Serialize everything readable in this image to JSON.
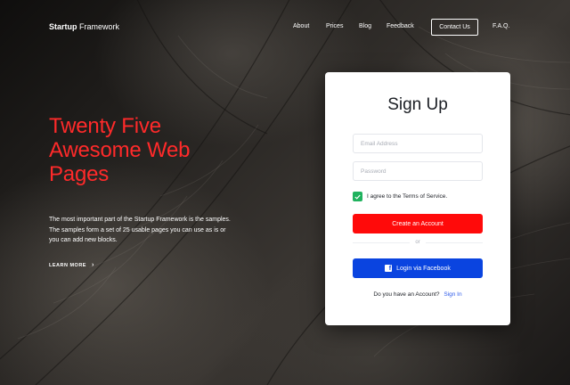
{
  "nav": {
    "brand_bold": "Startup",
    "brand_light": "Framework",
    "links": [
      "About",
      "Prices",
      "Blog",
      "Feedback"
    ],
    "contact_label": "Contact Us",
    "faq_label": "F.A.Q."
  },
  "hero": {
    "headline_lines": [
      "Twenty Five",
      "Awesome Web",
      "Pages"
    ],
    "description": "The most important part of the Startup Framework is the samples. The samples form a set of 25 usable pages you can use as is or you can add new blocks.",
    "learn_more": "LEARN MORE",
    "learn_more_icon": "chevron-right-icon"
  },
  "signup": {
    "title": "Sign Up",
    "email_placeholder": "Email Address",
    "password_placeholder": "Password",
    "terms_label": "I agree to the Terms of Service.",
    "terms_checked": true,
    "create_button": "Create an Account",
    "or_label": "or",
    "facebook_button": "Login via Facebook",
    "facebook_icon": "facebook-icon",
    "have_account": "Do you have an Account?",
    "sign_in_link": "Sign In"
  },
  "colors": {
    "headline": "#ff2a2a",
    "create_button": "#ff0a0a",
    "facebook_button": "#0a44e0",
    "checkbox": "#20b25e",
    "link": "#2f5bea"
  }
}
